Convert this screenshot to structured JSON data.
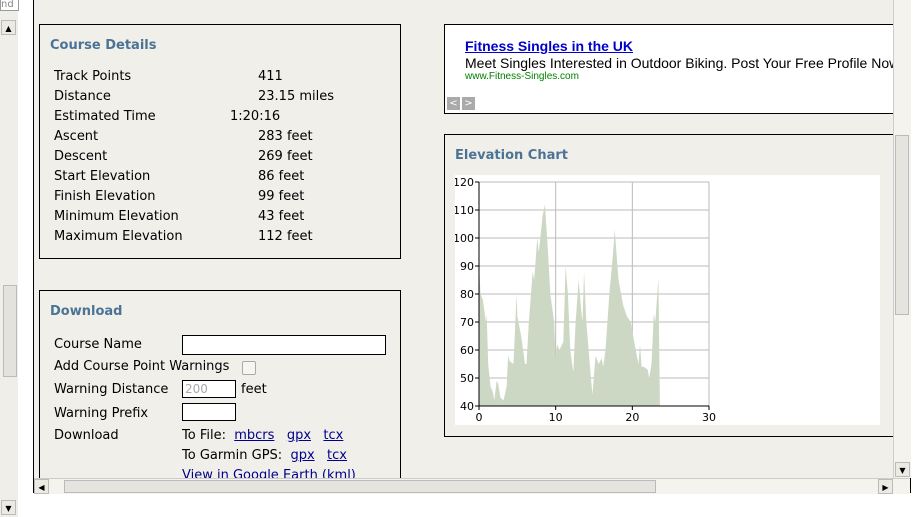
{
  "left_strip": {
    "input_fragment": "nd"
  },
  "course_details": {
    "title": "Course Details",
    "rows": [
      {
        "label": "Track Points",
        "value": "411"
      },
      {
        "label": "Distance",
        "value": "23.15 miles"
      },
      {
        "label": "Estimated Time",
        "value": "1:20:16"
      },
      {
        "label": "Ascent",
        "value": "283 feet"
      },
      {
        "label": "Descent",
        "value": "269 feet"
      },
      {
        "label": "Start Elevation",
        "value": "86 feet"
      },
      {
        "label": "Finish Elevation",
        "value": "99 feet"
      },
      {
        "label": "Minimum Elevation",
        "value": "43 feet"
      },
      {
        "label": "Maximum Elevation",
        "value": "112 feet"
      }
    ]
  },
  "download": {
    "title": "Download",
    "course_name_label": "Course Name",
    "course_name_value": "",
    "warnings_label": "Add Course Point Warnings",
    "warnings_checked": false,
    "warning_distance_label": "Warning Distance",
    "warning_distance_value": "200",
    "warning_distance_unit": "feet",
    "warning_prefix_label": "Warning Prefix",
    "warning_prefix_value": "",
    "download_label": "Download",
    "to_file_label": "To File:",
    "to_file_links": [
      "mbcrs",
      "gpx",
      "tcx"
    ],
    "to_garmin_label": "To Garmin GPS:",
    "to_garmin_links": [
      "gpx",
      "tcx"
    ],
    "google_earth_link": "View in Google Earth (kml)"
  },
  "ad": {
    "title": "Fitness Singles in the UK",
    "text": "Meet Singles Interested in Outdoor Biking. Post Your Free Profile Now",
    "url": "www.Fitness-Singles.com",
    "prev": "<",
    "next": ">"
  },
  "chart_data": {
    "type": "area",
    "title": "Elevation Chart",
    "xlim": [
      0,
      30
    ],
    "ylim": [
      40,
      120
    ],
    "xticks": [
      0,
      10,
      20,
      30
    ],
    "yticks": [
      40,
      50,
      60,
      70,
      80,
      90,
      100,
      110,
      120
    ],
    "grid": true,
    "color": "#cdd8c4",
    "x": [
      0,
      0.2,
      0.5,
      0.9,
      1.0,
      1.2,
      1.5,
      1.8,
      2.0,
      2.3,
      2.5,
      2.8,
      3.2,
      3.6,
      3.8,
      4.0,
      4.5,
      4.9,
      5.0,
      5.5,
      6.0,
      6.2,
      6.5,
      7.0,
      7.2,
      7.6,
      7.8,
      8.3,
      8.6,
      9.0,
      9.3,
      9.8,
      10.0,
      10.2,
      10.5,
      11.0,
      11.3,
      11.6,
      11.9,
      12.3,
      12.6,
      13.0,
      13.3,
      13.5,
      13.7,
      14.0,
      14.6,
      14.8,
      15.2,
      15.6,
      16.0,
      16.2,
      16.5,
      17.0,
      17.5,
      17.7,
      18.2,
      18.8,
      19.3,
      19.8,
      20.3,
      20.8,
      21.0,
      21.2,
      21.5,
      22.0,
      22.2,
      22.5,
      22.8,
      23.0,
      23.4,
      23.6
    ],
    "y": [
      90,
      80,
      78,
      70,
      73,
      55,
      47,
      45,
      42,
      49,
      48,
      43,
      42,
      47,
      58,
      56,
      55,
      80,
      72,
      65,
      55,
      55,
      70,
      88,
      85,
      100,
      95,
      108,
      112,
      95,
      80,
      70,
      57,
      62,
      60,
      63,
      90,
      80,
      60,
      52,
      70,
      85,
      75,
      70,
      88,
      70,
      50,
      44,
      58,
      55,
      57,
      54,
      60,
      80,
      95,
      103,
      85,
      76,
      72,
      70,
      62,
      55,
      62,
      54,
      54,
      53,
      50,
      55,
      73,
      70,
      86,
      40
    ]
  }
}
